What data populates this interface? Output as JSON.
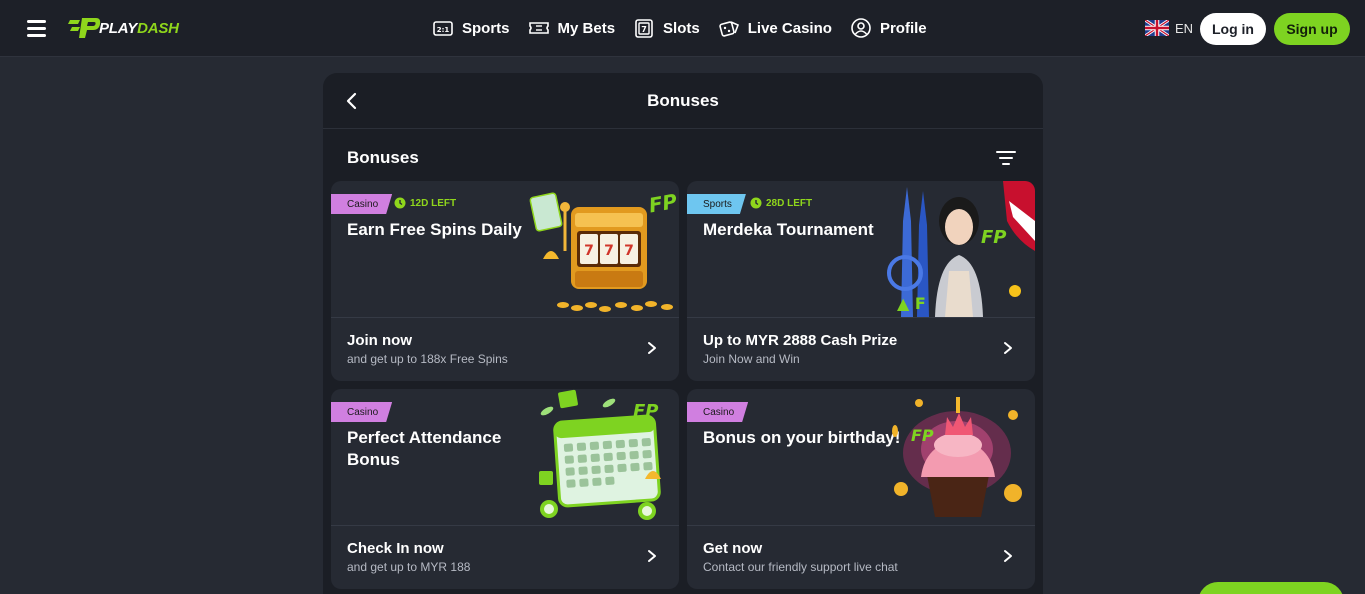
{
  "brand": {
    "logo_play": "PLAY",
    "logo_dash": "DASH",
    "accent": "#7ed321"
  },
  "nav": [
    {
      "icon": "sports-icon",
      "label": "Sports"
    },
    {
      "icon": "ticket-icon",
      "label": "My Bets"
    },
    {
      "icon": "slot-icon",
      "label": "Slots"
    },
    {
      "icon": "dice-icon",
      "label": "Live Casino"
    },
    {
      "icon": "profile-icon",
      "label": "Profile"
    }
  ],
  "header": {
    "language": "EN",
    "login_label": "Log in",
    "signup_label": "Sign up"
  },
  "page": {
    "title": "Bonuses",
    "section_title": "Bonuses"
  },
  "bonuses": [
    {
      "category": "Casino",
      "time_left": "12D LEFT",
      "title": "Earn Free Spins Daily",
      "cta": "Join now",
      "sub": "and get up to 188x Free Spins",
      "art": "slot-machine"
    },
    {
      "category": "Sports",
      "time_left": "28D LEFT",
      "title": "Merdeka Tournament",
      "cta": "Up to MYR 2888 Cash Prize",
      "sub": "Join Now and Win",
      "art": "merdeka"
    },
    {
      "category": "Casino",
      "time_left": "",
      "title": "Perfect Attendance Bonus",
      "cta": "Check In now",
      "sub": "and get up to MYR 188",
      "art": "calendar"
    },
    {
      "category": "Casino",
      "time_left": "",
      "title": "Bonus on your birthday!",
      "cta": "Get now",
      "sub": "Contact our friendly support live chat",
      "art": "cupcake"
    }
  ]
}
